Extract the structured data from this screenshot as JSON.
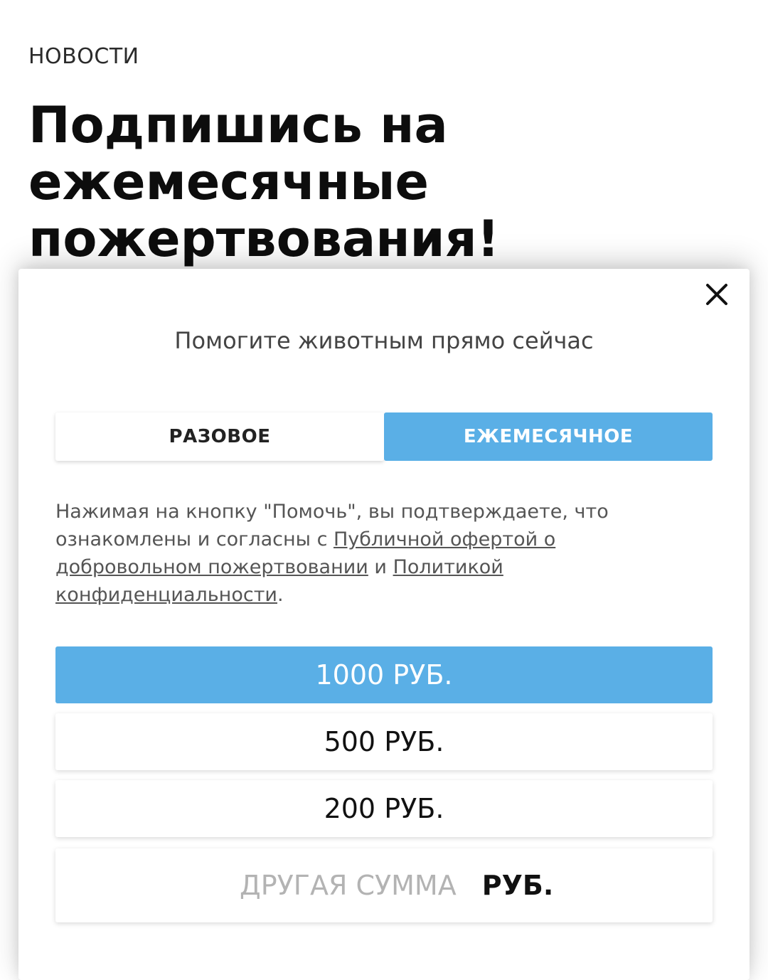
{
  "page": {
    "section_label": "НОВОСТИ",
    "headline": "Подпишись на ежемесячные пожертвования!"
  },
  "modal": {
    "close_icon": "close-icon",
    "title": "Помогите животным прямо сейчас",
    "toggle": {
      "options": [
        {
          "label": "РАЗОВОЕ",
          "selected": false
        },
        {
          "label": "ЕЖЕМЕСЯЧНОЕ",
          "selected": true
        }
      ]
    },
    "consent": {
      "text_1": "Нажимая на кнопку \"Помочь\", вы подтверждаете, что ознакомлены и согласны с ",
      "link_offer": "Публичной офертой о добровольном пожертвовании",
      "text_2": " и ",
      "link_policy": "Политикой конфиденциальности",
      "text_3": "."
    },
    "amounts": [
      {
        "label": "1000 РУБ.",
        "selected": true
      },
      {
        "label": "500 РУБ.",
        "selected": false
      },
      {
        "label": "200 РУБ.",
        "selected": false
      }
    ],
    "custom_amount": {
      "placeholder": "ДРУГАЯ СУММА",
      "value": "",
      "currency": "РУБ."
    }
  },
  "colors": {
    "accent": "#5aafe6",
    "text_dark": "#111111",
    "text_muted": "#555555"
  }
}
